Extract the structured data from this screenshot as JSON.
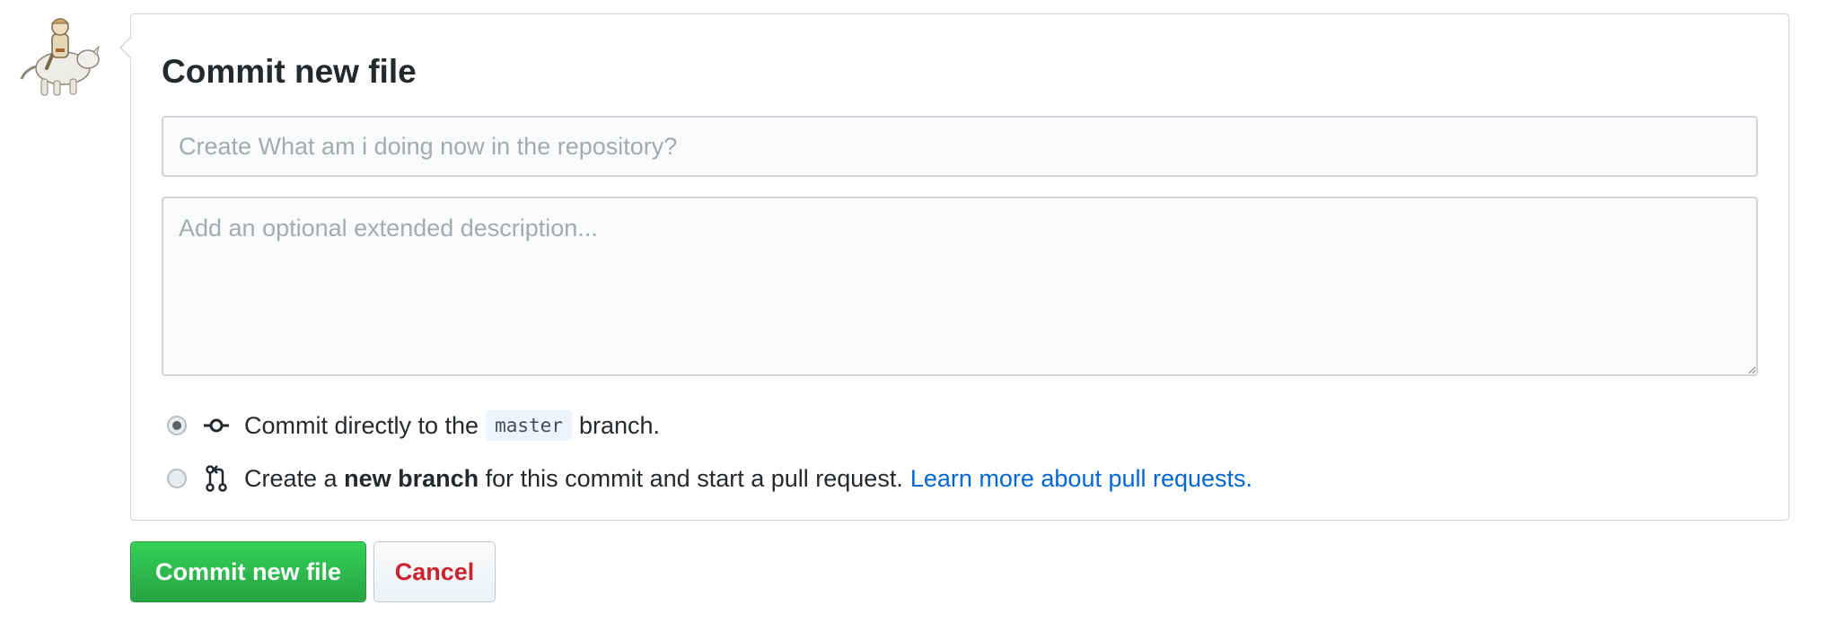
{
  "form": {
    "title": "Commit new file",
    "summary_placeholder": "Create What am i doing now in the repository?",
    "summary_value": "",
    "description_placeholder": "Add an optional extended description...",
    "description_value": ""
  },
  "options": {
    "direct": {
      "text_before": "Commit directly to the",
      "branch_name": "master",
      "text_after": "branch.",
      "selected": true,
      "icon": "git-commit-icon"
    },
    "new_branch": {
      "text_before": "Create a",
      "bold_text": "new branch",
      "text_after": "for this commit and start a pull request.",
      "link_text": "Learn more about pull requests.",
      "selected": false,
      "icon": "git-pull-request-icon"
    }
  },
  "buttons": {
    "commit_label": "Commit new file",
    "cancel_label": "Cancel"
  },
  "colors": {
    "commit_button": "#2ea44f",
    "cancel_text": "#cb2431",
    "link": "#0366d6",
    "branch_badge_bg": "#eaf5ff"
  }
}
